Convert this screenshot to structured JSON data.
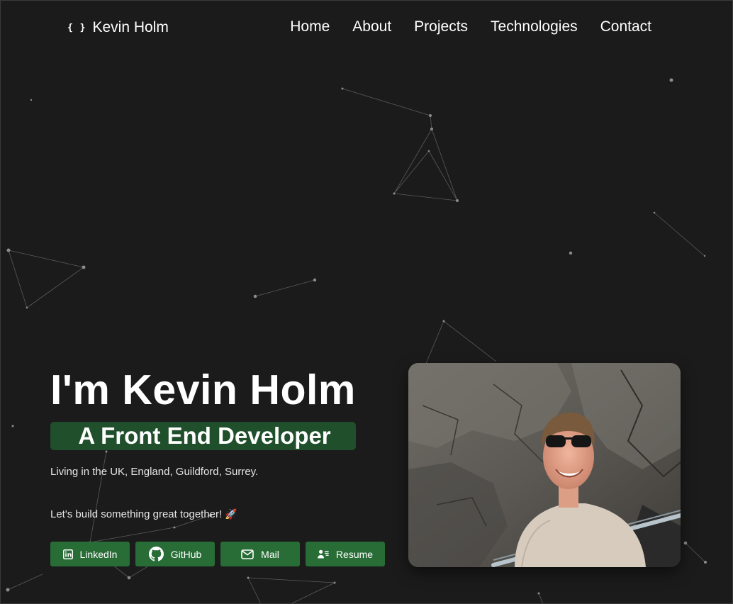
{
  "brand": {
    "icon": "curly-braces-icon",
    "brace_text": "{ }",
    "name": "Kevin Holm"
  },
  "nav": [
    "Home",
    "About",
    "Projects",
    "Technologies",
    "Contact"
  ],
  "hero": {
    "heading": "I'm Kevin Holm",
    "role": "A Front End Developer",
    "location": "Living in the UK, England, Guildford, Surrey.",
    "tagline": "Let's build something great together!",
    "tagline_emoji": "🚀",
    "photo_alt": "Photo of Kevin Holm"
  },
  "buttons": [
    {
      "label": "LinkedIn",
      "icon": "linkedin-icon"
    },
    {
      "label": "GitHub",
      "icon": "github-icon"
    },
    {
      "label": "Mail",
      "icon": "mail-icon"
    },
    {
      "label": "Resume",
      "icon": "resume-icon"
    }
  ],
  "colors": {
    "background": "#1b1b1b",
    "accent": "#286c36",
    "role_background": "#1f4f2b",
    "text": "#ffffff",
    "particle": "#8a8a8a"
  }
}
